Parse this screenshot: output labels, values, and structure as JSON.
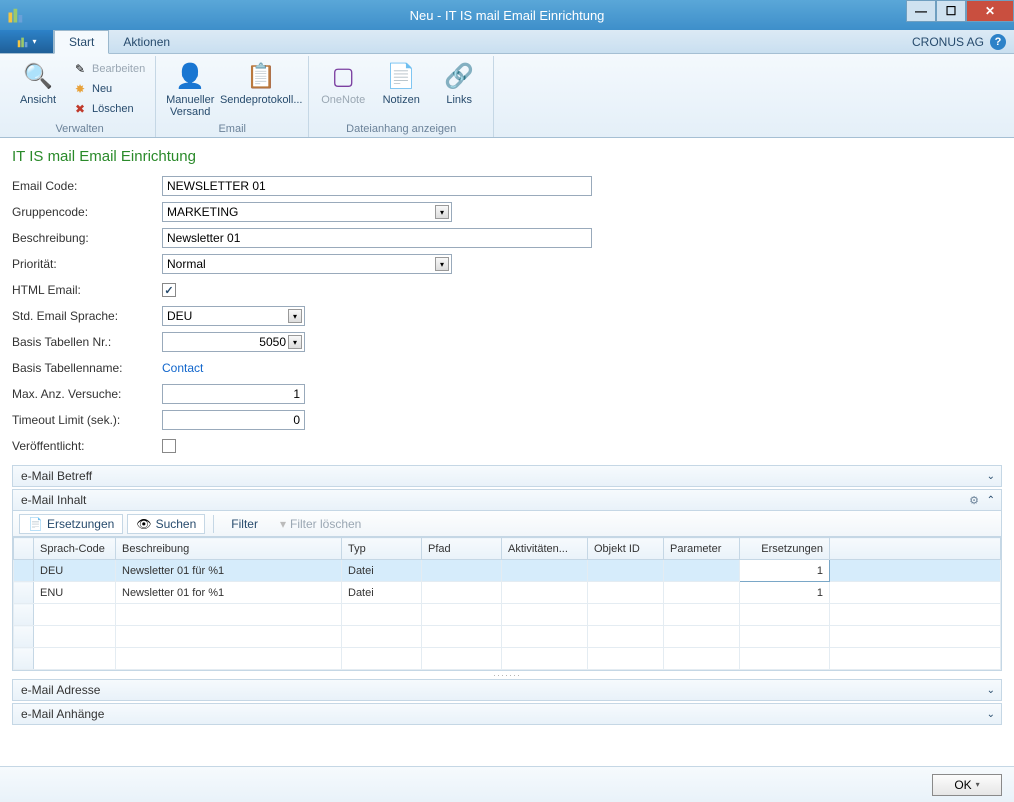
{
  "window": {
    "title": "Neu - IT IS mail Email Einrichtung"
  },
  "menubar": {
    "tab_start": "Start",
    "tab_aktionen": "Aktionen",
    "company": "CRONUS AG"
  },
  "ribbon": {
    "group_verwalten": "Verwalten",
    "group_email": "Email",
    "group_dateianhang": "Dateianhang anzeigen",
    "ansicht": "Ansicht",
    "bearbeiten": "Bearbeiten",
    "neu": "Neu",
    "loeschen": "Löschen",
    "manueller_versand": "Manueller\nVersand",
    "sendeprotokoll": "Sendeprotokoll...",
    "onenote": "OneNote",
    "notizen": "Notizen",
    "links": "Links"
  },
  "page": {
    "title": "IT IS mail Email Einrichtung"
  },
  "form": {
    "labels": {
      "email_code": "Email Code:",
      "gruppencode": "Gruppencode:",
      "beschreibung": "Beschreibung:",
      "prioritaet": "Priorität:",
      "html_email": "HTML Email:",
      "std_sprache": "Std. Email Sprache:",
      "basis_tab_nr": "Basis Tabellen Nr.:",
      "basis_tab_name": "Basis Tabellenname:",
      "max_versuche": "Max. Anz. Versuche:",
      "timeout": "Timeout Limit (sek.):",
      "veroeffentlicht": "Veröffentlicht:"
    },
    "values": {
      "email_code": "NEWSLETTER 01",
      "gruppencode": "MARKETING",
      "beschreibung": "Newsletter 01",
      "prioritaet": "Normal",
      "html_email": true,
      "std_sprache": "DEU",
      "basis_tab_nr": "5050",
      "basis_tab_name": "Contact",
      "max_versuche": "1",
      "timeout": "0",
      "veroeffentlicht": false
    }
  },
  "panels": {
    "betreff": "e-Mail Betreff",
    "inhalt": "e-Mail Inhalt",
    "adresse": "e-Mail Adresse",
    "anhaenge": "e-Mail Anhänge"
  },
  "grid_toolbar": {
    "ersetzungen": "Ersetzungen",
    "suchen": "Suchen",
    "filter": "Filter",
    "filter_loeschen": "Filter löschen"
  },
  "grid": {
    "headers": {
      "sprach_code": "Sprach-Code",
      "beschreibung": "Beschreibung",
      "typ": "Typ",
      "pfad": "Pfad",
      "aktivitaeten": "Aktivitäten...",
      "objekt_id": "Objekt ID",
      "parameter": "Parameter",
      "ersetzungen": "Ersetzungen"
    },
    "rows": [
      {
        "sprach_code": "DEU",
        "beschreibung": "Newsletter 01 für %1",
        "typ": "Datei",
        "pfad": "",
        "aktivitaeten": "",
        "objekt_id": "",
        "parameter": "",
        "ersetzungen": "1"
      },
      {
        "sprach_code": "ENU",
        "beschreibung": "Newsletter 01 for %1",
        "typ": "Datei",
        "pfad": "",
        "aktivitaeten": "",
        "objekt_id": "",
        "parameter": "",
        "ersetzungen": "1"
      }
    ]
  },
  "footer": {
    "ok": "OK"
  }
}
